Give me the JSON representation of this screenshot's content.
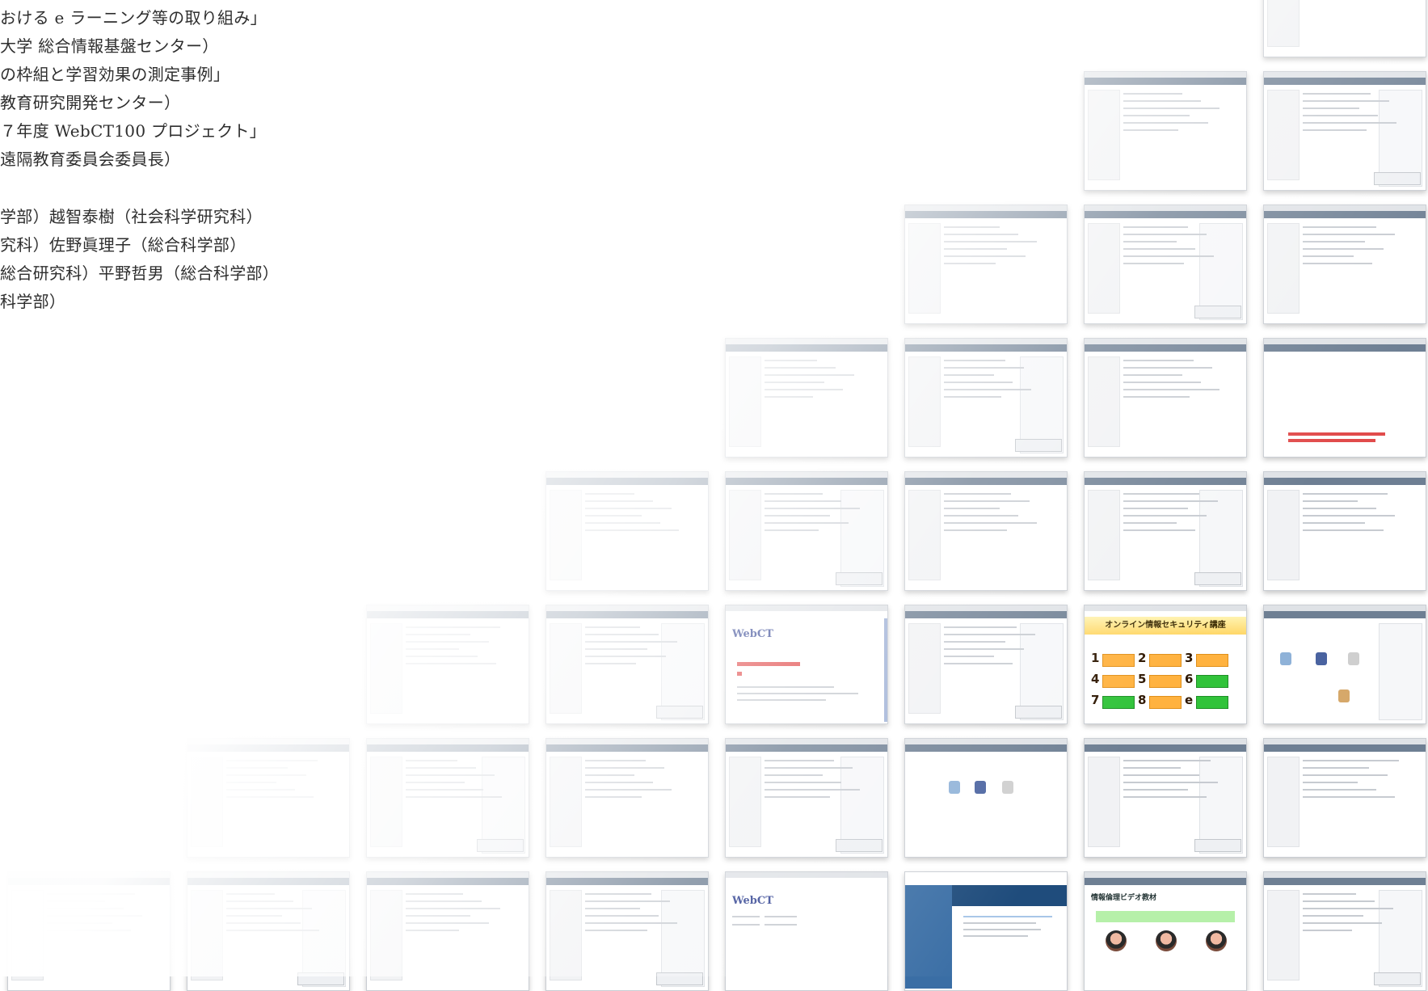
{
  "text_lines": [
    "おける e ラーニング等の取り組み」",
    "大学 総合情報基盤センター）",
    "の枠組と学習効果の測定事例」",
    "教育研究開発センター）",
    "７年度 WebCT100 プロジェクト」",
    "遠隔教育委員会委員長）",
    "学部）越智泰樹（社会科学研究科）",
    "究科）佐野眞理子（総合科学部）",
    "総合研究科）平野哲男（総合科学部）",
    "科学部）"
  ],
  "tiles": {
    "webct_logo": "WebCT",
    "security_title": "オンライン情報セキュリティ講座",
    "security_numbers": [
      "1",
      "2",
      "3",
      "4",
      "5",
      "6",
      "7",
      "8",
      "e"
    ],
    "video_title": "情報倫理ビデオ教材"
  },
  "colors": {
    "nav_bar": "#6e7f93",
    "accent_orange": "#ffb23f",
    "accent_green": "#31c33a",
    "accent_red": "#e14b4b"
  }
}
